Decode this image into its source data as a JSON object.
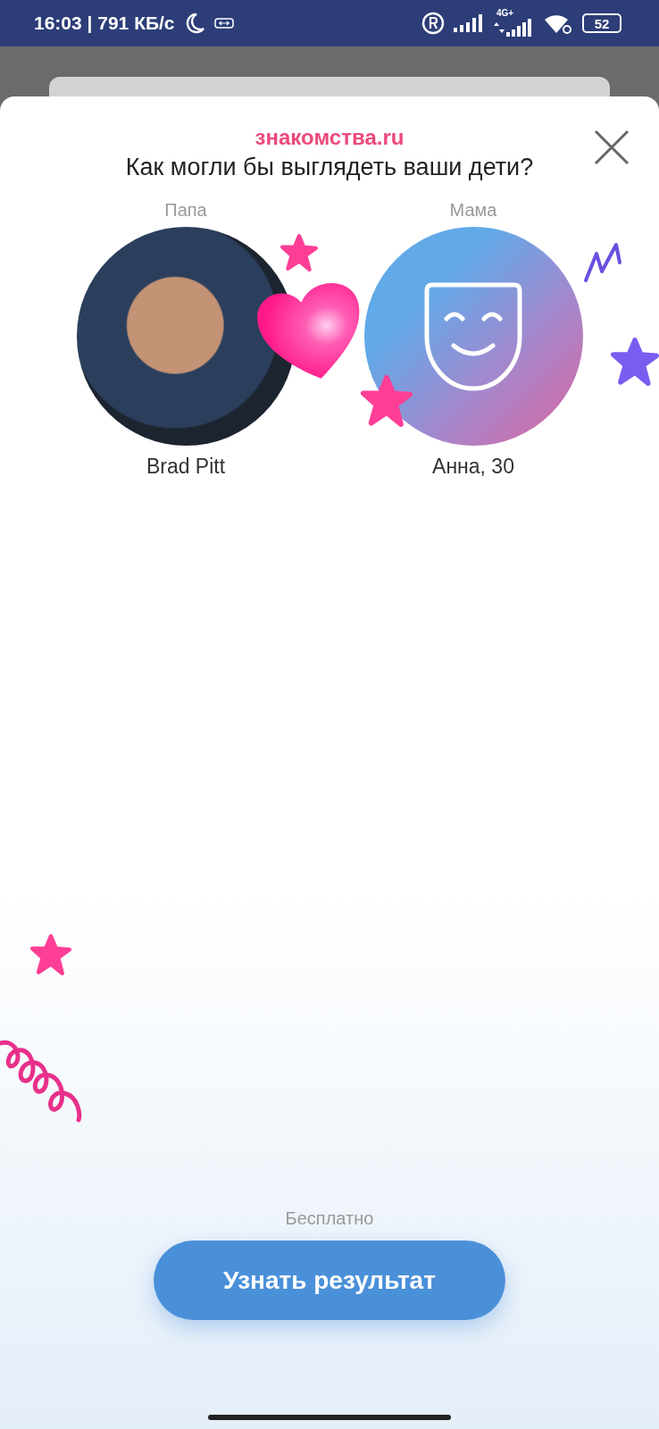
{
  "status_bar": {
    "time": "16:03 | 791 КБ/с",
    "network": "4G+",
    "battery": "52"
  },
  "sheet": {
    "logo": "знакомства.ru",
    "title": "Как могли бы выглядеть ваши дети?",
    "parents": [
      {
        "role": "Папа",
        "name": "Brad Pitt",
        "kind": "photo"
      },
      {
        "role": "Мама",
        "name": "Анна, 30",
        "kind": "placeholder"
      }
    ],
    "price": "Бесплатно",
    "button": "Узнать результат"
  }
}
